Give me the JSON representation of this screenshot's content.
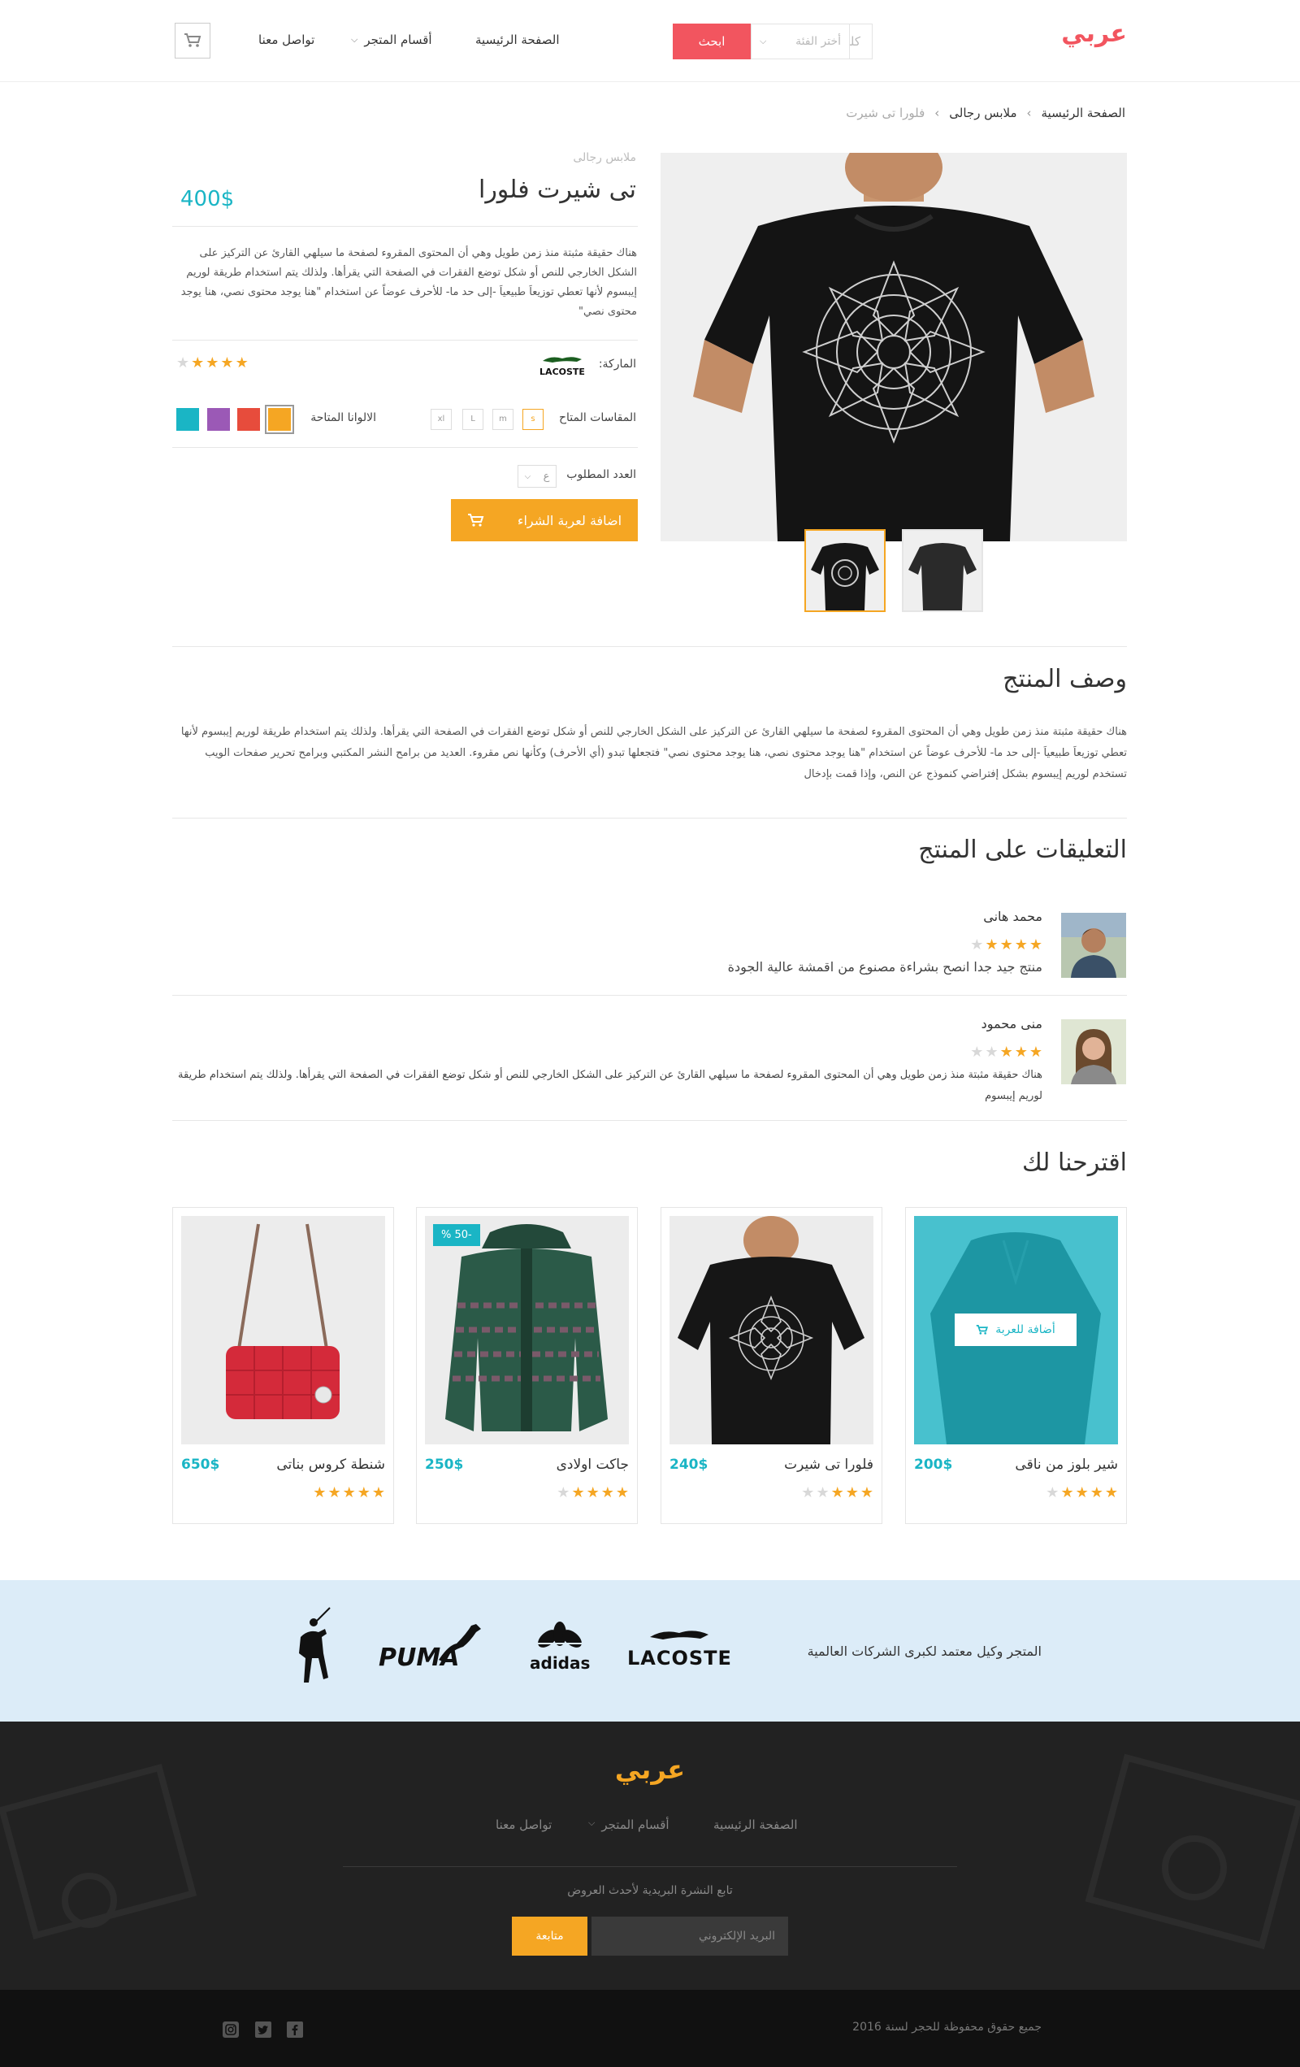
{
  "header": {
    "logo": "عربي",
    "search_placeholder": "كلمة البحث..",
    "category_select": "أختر الفئة",
    "search_button": "ابحث",
    "nav": {
      "home": "الصفحة الرئيسية",
      "departments": "أقسام المتجر",
      "contact": "تواصل معنا"
    }
  },
  "breadcrumb": {
    "home": "الصفحة الرئيسية",
    "category": "ملابس رجالى",
    "current": "فلورا تى شيرت"
  },
  "product": {
    "category": "ملابس رجالى",
    "title": "تى شيرت فلورا",
    "price": "400$",
    "description": "هناك حقيقة مثبتة منذ زمن طويل وهي أن المحتوى المقروء لصفحة ما سيلهي القارئ عن التركيز على الشكل الخارجي للنص أو شكل توضع الفقرات في الصفحة التي يقرأها. ولذلك يتم استخدام طريقة لوريم إيبسوم لأنها تعطي توزيعاَ طبيعياَ -إلى حد ما- للأحرف عوضاً عن استخدام \"هنا يوجد محتوى نصي، هنا يوجد محتوى نصي\"",
    "brand_label": "الماركة:",
    "brand_name": "LACOSTE",
    "rating": 4,
    "sizes_label": "المقاسات المتاح",
    "sizes": [
      "s",
      "m",
      "L",
      "xl"
    ],
    "colors_label": "الالوانا المتاحة",
    "colors": [
      "#f5a623",
      "#e74c3c",
      "#9b59b6",
      "#1ab5c5"
    ],
    "qty_label": "العدد المطلوب",
    "qty_value": "ع",
    "add_to_cart": "اضافة لعربة الشراء"
  },
  "description_section": {
    "title": "وصف المنتج",
    "text": "هناك حقيقة مثبتة منذ زمن طويل وهي أن المحتوى المقروء لصفحة ما سيلهي القارئ عن التركيز على الشكل الخارجي للنص أو شكل توضع الفقرات في الصفحة التي يقرأها. ولذلك يتم استخدام طريقة لوريم إيبسوم لأنها تعطي توزيعاَ طبيعياَ -إلى حد ما- للأحرف عوضاً عن استخدام \"هنا يوجد محتوى نصي، هنا يوجد محتوى نصي\" فتجعلها تبدو (أي الأحرف) وكأنها نص مقروء. العديد من برامح النشر المكتبي وبرامح تحرير صفحات الويب تستخدم لوريم إيبسوم بشكل إفتراضي كنموذج عن النص، وإذا قمت بإدخال"
  },
  "reviews": {
    "title": "التعليقات على المنتج",
    "items": [
      {
        "name": "محمد هانى",
        "rating": 4,
        "text": "منتج جيد جدا انصح بشراءة مصنوع من اقمشة عالية الجودة"
      },
      {
        "name": "منى محمود",
        "rating": 3,
        "text": "هناك حقيقة مثبتة منذ زمن طويل وهي أن المحتوى المقروء لصفحة ما سيلهي القارئ عن التركيز على الشكل الخارجي للنص أو شكل توضع الفقرات في الصفحة التي يقرأها. ولذلك يتم استخدام طريقة لوريم إيبسوم"
      }
    ]
  },
  "suggestions": {
    "title": "اقترحنا لك",
    "add_to_cart_overlay": "أضافة للعربة",
    "items": [
      {
        "name": "شير بلوز من ناقى",
        "price": "200$",
        "rating": 4
      },
      {
        "name": "فلورا تى شيرت",
        "price": "240$",
        "rating": 3
      },
      {
        "name": "جاكت اولادى",
        "price": "250$",
        "rating": 4,
        "badge": "-50 %"
      },
      {
        "name": "شنطة كروس بناتى",
        "price": "650$",
        "rating": 5
      }
    ]
  },
  "brands": {
    "text": "المتجر وكيل معتمد لكبرى الشركات العالمية",
    "names": [
      "LACOSTE",
      "adidas",
      "PUMA"
    ]
  },
  "footer": {
    "logo": "عربي",
    "nav": {
      "home": "الصفحة الرئيسية",
      "departments": "أقسام المتجر",
      "contact": "تواصل معنا"
    },
    "newsletter_text": "تابع النشرة البريدية لأحدث العروض",
    "email_placeholder": "البريد الإلكتروني",
    "subscribe": "متابعة",
    "copyright": "جميع حقوق محفوظة للحجر لسنة 2016"
  }
}
